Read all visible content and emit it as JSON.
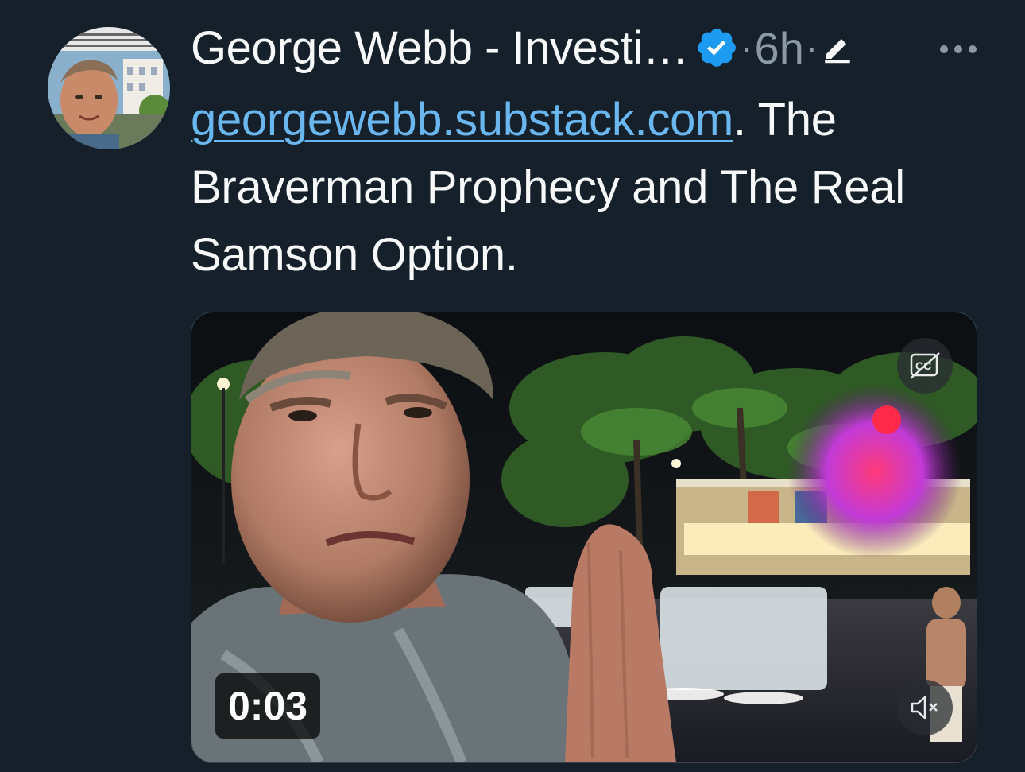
{
  "tweet": {
    "author_name": "George Webb - Investi…",
    "separator": "·",
    "timestamp": "6h",
    "link_text": "georgewebb.substack.com",
    "text_after_link": ". The Braverman Prophecy and The Real Samson Option."
  },
  "media": {
    "duration": "0:03"
  },
  "icons": {
    "verified": "verified-badge-icon",
    "edit": "pencil-edit-icon",
    "more": "more-dots-icon",
    "captions": "closed-captions-off-icon",
    "mute": "volume-muted-icon"
  },
  "colors": {
    "background": "#15202b",
    "link": "#6ab7ef",
    "verified": "#1d9bf0",
    "muted_text": "#8b98a5"
  }
}
